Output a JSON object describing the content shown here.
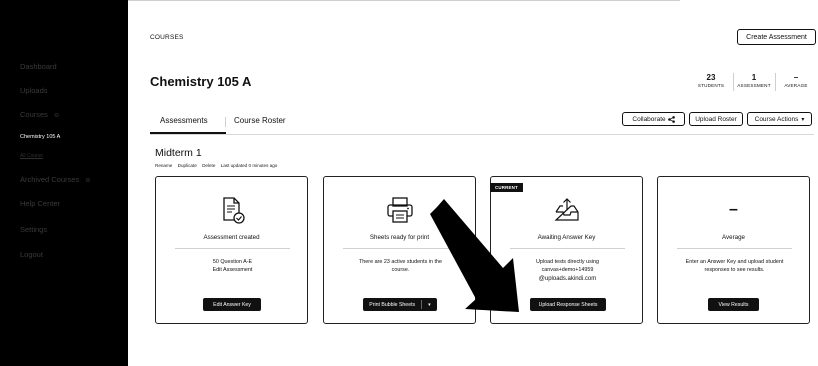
{
  "sidebar": {
    "items": [
      {
        "label": "Dashboard"
      },
      {
        "label": "Uploads"
      },
      {
        "label": "Courses",
        "caret": "⊖"
      },
      {
        "label": "Chemistry 105 A"
      },
      {
        "label": "All Course"
      },
      {
        "label": "Archived Courses",
        "caret": "⊖"
      },
      {
        "label": "Help Center"
      },
      {
        "label": "Settings"
      },
      {
        "label": "Logout"
      }
    ]
  },
  "header": {
    "breadcrumb": "COURSES",
    "create_label": "Create Assessment",
    "course_title": "Chemistry 105 A",
    "stats": [
      {
        "value": "23",
        "label": "STUDENTS"
      },
      {
        "value": "1",
        "label": "ASSESSMENT"
      },
      {
        "value": "–",
        "label": "AVERAGE"
      }
    ]
  },
  "tabs": [
    {
      "label": "Assessments",
      "active": true
    },
    {
      "label": "Course Roster",
      "active": false
    }
  ],
  "actions": {
    "collaborate": "Collaborate ",
    "collaborate_icon": "share-icon",
    "upload_roster": "Upload Roster",
    "course_actions": "Course Actions",
    "course_actions_caret": "▾"
  },
  "exam": {
    "title": "Midterm 1",
    "links": [
      "Rename",
      "Duplicate",
      "Delete"
    ],
    "updated": "Last updated 0 minutes ago"
  },
  "cards": [
    {
      "icon": "document-check-icon",
      "title": "Assessment created",
      "body_lines": [
        "50 Question A-E",
        "Edit Assessment"
      ],
      "button": "Edit Answer Key"
    },
    {
      "icon": "printer-icon",
      "title": "Sheets ready for print",
      "body_lines": [
        "There are 23 active students in the",
        "course."
      ],
      "button": "Print Bubble Sheets",
      "button_caret": "▾"
    },
    {
      "badge": "CURRENT",
      "icon": "inbox-upload-icon",
      "title": "Awaiting Answer Key",
      "body_lines": [
        "Upload tests directly using",
        "canvas+demo+14959",
        "@uploads.akindi.com"
      ],
      "button": "Upload Response Sheets"
    },
    {
      "value": "–",
      "title": "Average",
      "body_lines": [
        "Enter an Answer Key and upload student",
        "responses to see results."
      ],
      "button": "View Results"
    }
  ],
  "colors": {
    "sidebar_bg": "#000000",
    "accent": "#111111",
    "divider": "#d0d0d0"
  }
}
